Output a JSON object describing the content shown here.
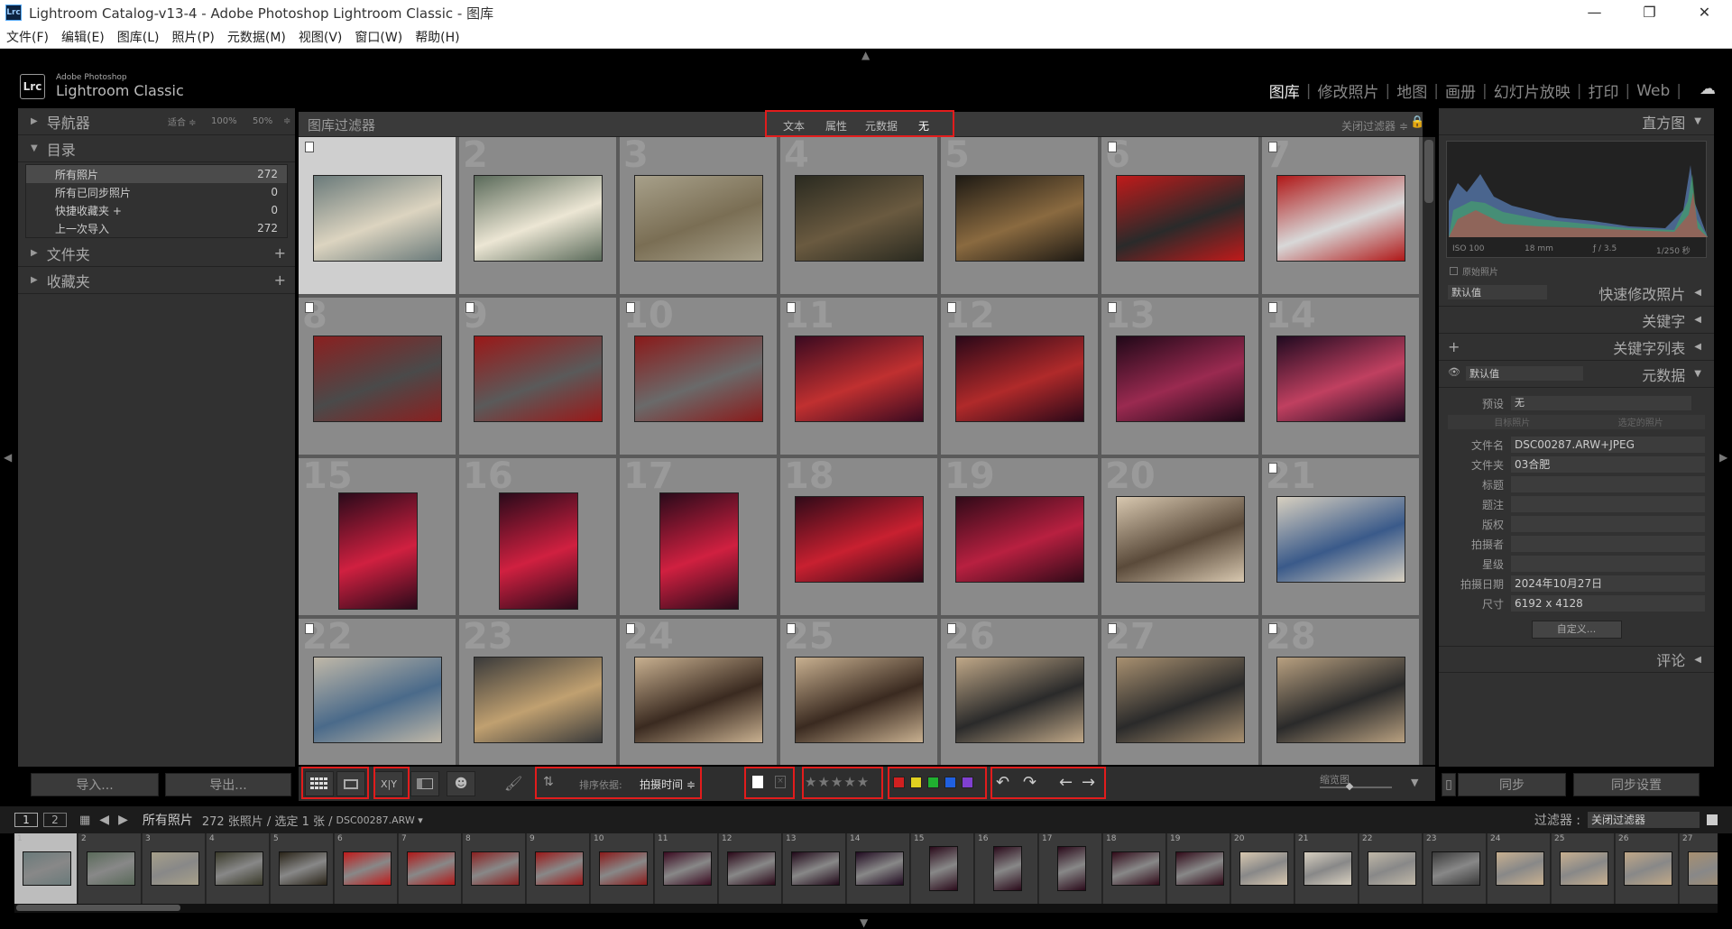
{
  "window": {
    "title": "Lightroom Catalog-v13-4 - Adobe Photoshop Lightroom Classic - 图库",
    "app_badge": "Lrc",
    "controls": [
      "—",
      "❐",
      "✕"
    ]
  },
  "menu": [
    "文件(F)",
    "编辑(E)",
    "图库(L)",
    "照片(P)",
    "元数据(M)",
    "视图(V)",
    "窗口(W)",
    "帮助(H)"
  ],
  "identity": {
    "line1": "Adobe Photoshop",
    "line2": "Lightroom Classic",
    "badge": "Lrc"
  },
  "modules": [
    "图库",
    "修改照片",
    "地图",
    "画册",
    "幻灯片放映",
    "打印",
    "Web"
  ],
  "left": {
    "navigator": {
      "label": "导航器",
      "zoom": [
        "适合 ≑",
        "100%",
        "50%",
        "≑"
      ]
    },
    "catalog": {
      "label": "目录",
      "items": [
        {
          "name": "所有照片",
          "count": "272"
        },
        {
          "name": "所有已同步照片",
          "count": "0"
        },
        {
          "name": "快捷收藏夹 +",
          "count": "0"
        },
        {
          "name": "上一次导入",
          "count": "272"
        }
      ]
    },
    "folders": {
      "label": "文件夹",
      "add": "+"
    },
    "collections": {
      "label": "收藏夹",
      "add": "+"
    },
    "import": "导入...",
    "export": "导出..."
  },
  "filterbar": {
    "label": "图库过滤器",
    "options": [
      "文本",
      "属性",
      "元数据",
      "无"
    ],
    "close": "关闭过滤器 ≑"
  },
  "grid": {
    "numbers": [
      "",
      "2",
      "3",
      "4",
      "5",
      "6",
      "7",
      "8",
      "9",
      "10",
      "11",
      "12",
      "13",
      "14",
      "15",
      "16",
      "17",
      "18",
      "19",
      "20",
      "21",
      "22",
      "23",
      "24",
      "25",
      "26",
      "27",
      "28"
    ]
  },
  "right": {
    "histogram": {
      "label": "直方图",
      "info": [
        "ISO 100",
        "18 mm",
        "ƒ / 3.5",
        "1/250 秒"
      ],
      "original": "原始照片"
    },
    "quick_develop": {
      "preset": "默认值",
      "label": "快速修改照片"
    },
    "keywords": "关键字",
    "keyword_list": "关键字列表",
    "metadata": {
      "preset": "默认值",
      "label": "元数据",
      "preset_label": "预设",
      "preset_value": "无",
      "tabs": [
        "目标照片",
        "选定的照片"
      ],
      "fields": [
        {
          "label": "文件名",
          "value": "DSC00287.ARW+JPEG"
        },
        {
          "label": "文件夹",
          "value": "03合肥"
        },
        {
          "label": "标题",
          "value": ""
        },
        {
          "label": "题注",
          "value": ""
        },
        {
          "label": "版权",
          "value": ""
        },
        {
          "label": "拍摄者",
          "value": ""
        },
        {
          "label": "星级",
          "value": ""
        },
        {
          "label": "拍摄日期",
          "value": "2024年10月27日"
        },
        {
          "label": "尺寸",
          "value": "6192 x 4128"
        }
      ],
      "customize": "自定义..."
    },
    "comments": "评论",
    "sync": "同步",
    "sync_settings": "同步设置"
  },
  "toolbar": {
    "sort_label": "排序依据:",
    "sort_value": "拍摄时间 ≑",
    "thumb_label": "缩览图",
    "xy": "X|Y"
  },
  "filmstrip": {
    "breadcrumb": "所有照片",
    "count": "272 张照片 / 选定 1 张 /",
    "filename": "DSC00287.ARW ▾",
    "filter_label": "过滤器 :",
    "filter_value": "关闭过滤器",
    "screens": [
      "1",
      "2"
    ],
    "numbers": [
      "1",
      "2",
      "3",
      "4",
      "5",
      "6",
      "7",
      "8",
      "9",
      "10",
      "11",
      "12",
      "13",
      "14",
      "15",
      "16",
      "17",
      "18",
      "19",
      "20",
      "21",
      "22",
      "23",
      "24",
      "25",
      "26",
      "27"
    ]
  },
  "colors": {
    "labels": [
      "#d02020",
      "#e0d020",
      "#20b030",
      "#2060e0",
      "#8040d0"
    ],
    "accent": "#e21c1c"
  }
}
